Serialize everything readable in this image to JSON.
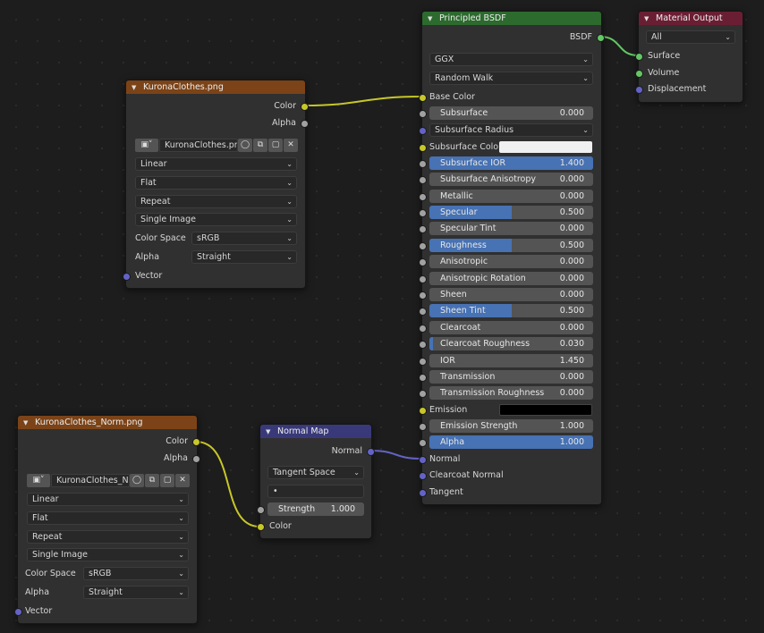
{
  "colors": {
    "image_header": "#7b4317",
    "shader_header": "#2c6a2e",
    "vector_header": "#39397a",
    "output_header": "#6a1e34",
    "socket_color": "#c7c729",
    "socket_float": "#a1a1a1",
    "socket_vector": "#6363c7",
    "socket_shader": "#63c763",
    "slider_fill": "#4772b3"
  },
  "image_node_1": {
    "title": "KuronaClothes.png",
    "outputs": {
      "color": "Color",
      "alpha": "Alpha"
    },
    "image_name": "KuronaClothes.png",
    "interpolation": "Linear",
    "projection": "Flat",
    "extension": "Repeat",
    "source": "Single Image",
    "color_space_label": "Color Space",
    "color_space_value": "sRGB",
    "alpha_label": "Alpha",
    "alpha_value": "Straight",
    "vector_label": "Vector"
  },
  "image_node_2": {
    "title": "KuronaClothes_Norm.png",
    "outputs": {
      "color": "Color",
      "alpha": "Alpha"
    },
    "image_name": "KuronaClothes_No...",
    "interpolation": "Linear",
    "projection": "Flat",
    "extension": "Repeat",
    "source": "Single Image",
    "color_space_label": "Color Space",
    "color_space_value": "sRGB",
    "alpha_label": "Alpha",
    "alpha_value": "Straight",
    "vector_label": "Vector"
  },
  "normal_map": {
    "title": "Normal Map",
    "output": "Normal",
    "space": "Tangent Space",
    "uv_map": "•",
    "strength_label": "Strength",
    "strength_value": "1.000",
    "color_label": "Color"
  },
  "bsdf": {
    "title": "Principled BSDF",
    "output": "BSDF",
    "distribution": "GGX",
    "subsurface_method": "Random Walk",
    "base_color": "Base Color",
    "subsurface_radius": "Subsurface Radius",
    "subsurface_color": "Subsurface Color",
    "emission": "Emission",
    "normal": "Normal",
    "clearcoat_normal": "Clearcoat Normal",
    "tangent": "Tangent",
    "fields": [
      {
        "label": "Subsurface",
        "value": "0.000",
        "fill": 0
      },
      {
        "label": "Subsurface IOR",
        "value": "1.400",
        "fill": 1.0
      },
      {
        "label": "Subsurface Anisotropy",
        "value": "0.000",
        "fill": 0
      },
      {
        "label": "Metallic",
        "value": "0.000",
        "fill": 0
      },
      {
        "label": "Specular",
        "value": "0.500",
        "fill": 0.5
      },
      {
        "label": "Specular Tint",
        "value": "0.000",
        "fill": 0
      },
      {
        "label": "Roughness",
        "value": "0.500",
        "fill": 0.5
      },
      {
        "label": "Anisotropic",
        "value": "0.000",
        "fill": 0
      },
      {
        "label": "Anisotropic Rotation",
        "value": "0.000",
        "fill": 0
      },
      {
        "label": "Sheen",
        "value": "0.000",
        "fill": 0
      },
      {
        "label": "Sheen Tint",
        "value": "0.500",
        "fill": 0.5
      },
      {
        "label": "Clearcoat",
        "value": "0.000",
        "fill": 0
      },
      {
        "label": "Clearcoat Roughness",
        "value": "0.030",
        "fill": 0.03
      },
      {
        "label": "IOR",
        "value": "1.450",
        "fill": 0
      },
      {
        "label": "Transmission",
        "value": "0.000",
        "fill": 0
      },
      {
        "label": "Transmission Roughness",
        "value": "0.000",
        "fill": 0
      },
      {
        "label": "Emission Strength",
        "value": "1.000",
        "fill": 0
      },
      {
        "label": "Alpha",
        "value": "1.000",
        "fill": 1.0
      }
    ]
  },
  "material_output": {
    "title": "Material Output",
    "target": "All",
    "surface": "Surface",
    "volume": "Volume",
    "displacement": "Displacement"
  }
}
